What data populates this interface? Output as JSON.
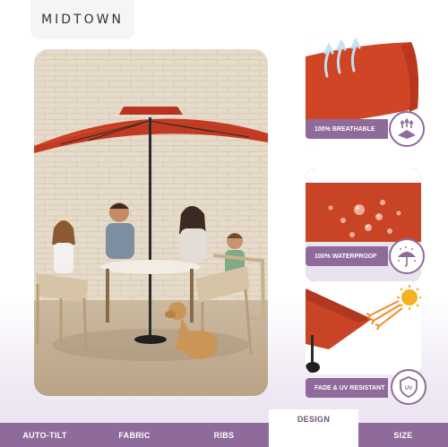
{
  "brand": "MIDTOWN",
  "accent_color": "#8e6b9a",
  "canopy_color": "#d1472b",
  "features": [
    {
      "label": "100% BREATHABLE",
      "icon": "breathable-icon"
    },
    {
      "label": "100% WATERPROOF",
      "icon": "umbrella-rain-icon"
    },
    {
      "label": "FADE & UV RESISTANT",
      "icon": "uv-shield-icon",
      "badge_text": "UV"
    }
  ],
  "tabs": [
    {
      "label": "AUTO-TILT"
    },
    {
      "label": "FABRIC"
    },
    {
      "label": "RIBS"
    },
    {
      "label": "DESIGN",
      "active": true
    },
    {
      "label": "SIZE"
    }
  ]
}
